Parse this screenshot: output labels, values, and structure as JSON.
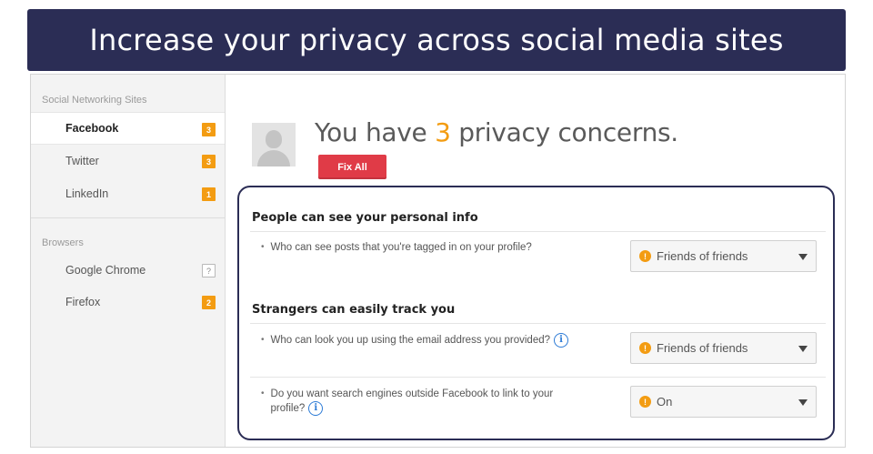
{
  "banner": {
    "title": "Increase your privacy across social media sites"
  },
  "sidebar": {
    "social_section": "Social Networking Sites",
    "social_items": [
      {
        "label": "Facebook",
        "badge": "3",
        "active": true
      },
      {
        "label": "Twitter",
        "badge": "3"
      },
      {
        "label": "LinkedIn",
        "badge": "1"
      }
    ],
    "browsers_section": "Browsers",
    "browser_items": [
      {
        "label": "Google Chrome",
        "badge": "?"
      },
      {
        "label": "Firefox",
        "badge": "2"
      }
    ]
  },
  "main": {
    "headline_prefix": "You have ",
    "headline_count": "3",
    "headline_suffix": " privacy concerns.",
    "fix_all_label": "Fix All",
    "sections": [
      {
        "title": "People can see your personal info",
        "questions": [
          {
            "text": "Who can see posts that you're tagged in on your profile?",
            "value": "Friends of friends"
          }
        ]
      },
      {
        "title": "Strangers can easily track you",
        "questions": [
          {
            "text": "Who can look you up using the email address you provided?",
            "value": "Friends of friends"
          },
          {
            "text": "Do you want search engines outside Facebook to link to your profile?",
            "value": "On"
          }
        ]
      }
    ]
  },
  "colors": {
    "banner": "#2b2d55",
    "accent": "#f39c12",
    "fix_button": "#e03b47",
    "info": "#2d7bd6"
  }
}
